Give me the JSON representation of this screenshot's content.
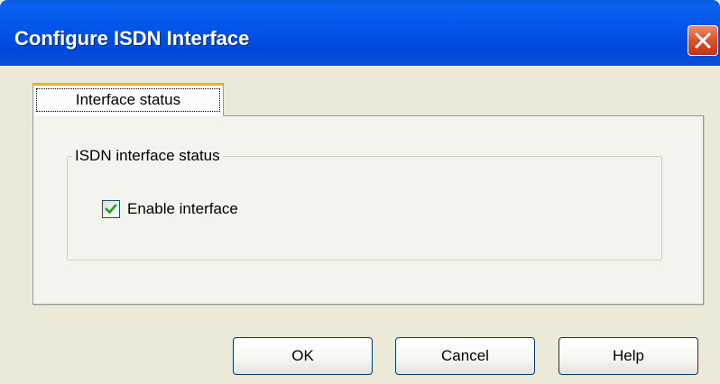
{
  "window": {
    "title": "Configure ISDN Interface"
  },
  "tabs": [
    {
      "label": "Interface status",
      "selected": true
    }
  ],
  "group": {
    "legend": "ISDN interface status",
    "enable_checkbox": {
      "label": "Enable interface",
      "checked": true
    }
  },
  "buttons": {
    "ok": "OK",
    "cancel": "Cancel",
    "help": "Help"
  },
  "colors": {
    "titlebar": "#0254ea",
    "close_button": "#d9512c",
    "tab_highlight": "#f2b01f",
    "checkmark": "#21a121",
    "dialog_background": "#ece9d8"
  },
  "icons": {
    "close": "close-icon",
    "check": "checkmark-icon"
  }
}
